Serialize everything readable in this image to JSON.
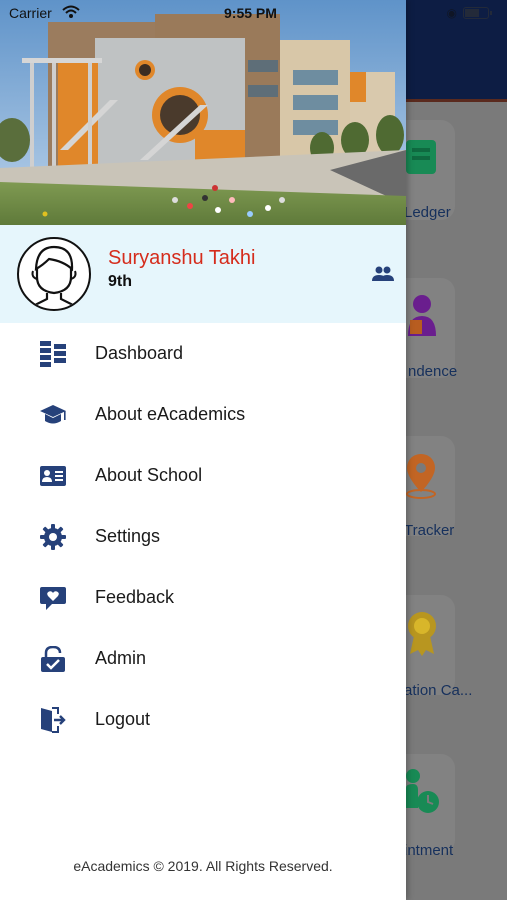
{
  "status_bar": {
    "carrier": "Carrier",
    "time": "9:55 PM"
  },
  "background": {
    "tiles": [
      {
        "label": "Ledger",
        "icon": "ledger-icon"
      },
      {
        "label": "ndence",
        "icon": "attendance-icon"
      },
      {
        "label": "Tracker",
        "icon": "location-pin-icon"
      },
      {
        "label": "ation Ca...",
        "icon": "award-badge-icon"
      },
      {
        "label": "intment",
        "icon": "appointment-icon"
      }
    ],
    "colors": {
      "header": "#0d1d44",
      "accent_green": "#1faa6e",
      "accent_purple": "#7a2aa8",
      "accent_orange": "#d8722a"
    }
  },
  "drawer": {
    "header_image": "school-building-photo",
    "profile": {
      "name": "Suryanshu Takhi",
      "class": "9th",
      "switch_icon": "switch-user-icon"
    },
    "menu": [
      {
        "label": "Dashboard",
        "icon": "dashboard-grid-icon"
      },
      {
        "label": "About eAcademics",
        "icon": "graduation-cap-icon"
      },
      {
        "label": "About School",
        "icon": "id-card-icon"
      },
      {
        "label": "Settings",
        "icon": "gear-icon"
      },
      {
        "label": "Feedback",
        "icon": "feedback-heart-icon"
      },
      {
        "label": "Admin",
        "icon": "admin-lock-icon"
      },
      {
        "label": "Logout",
        "icon": "logout-door-icon"
      }
    ],
    "footer": "eAcademics © 2019. All Rights Reserved.",
    "colors": {
      "name": "#d52c1c",
      "profile_bg": "#e6f6fc",
      "icon_blue": "#26417a"
    }
  }
}
